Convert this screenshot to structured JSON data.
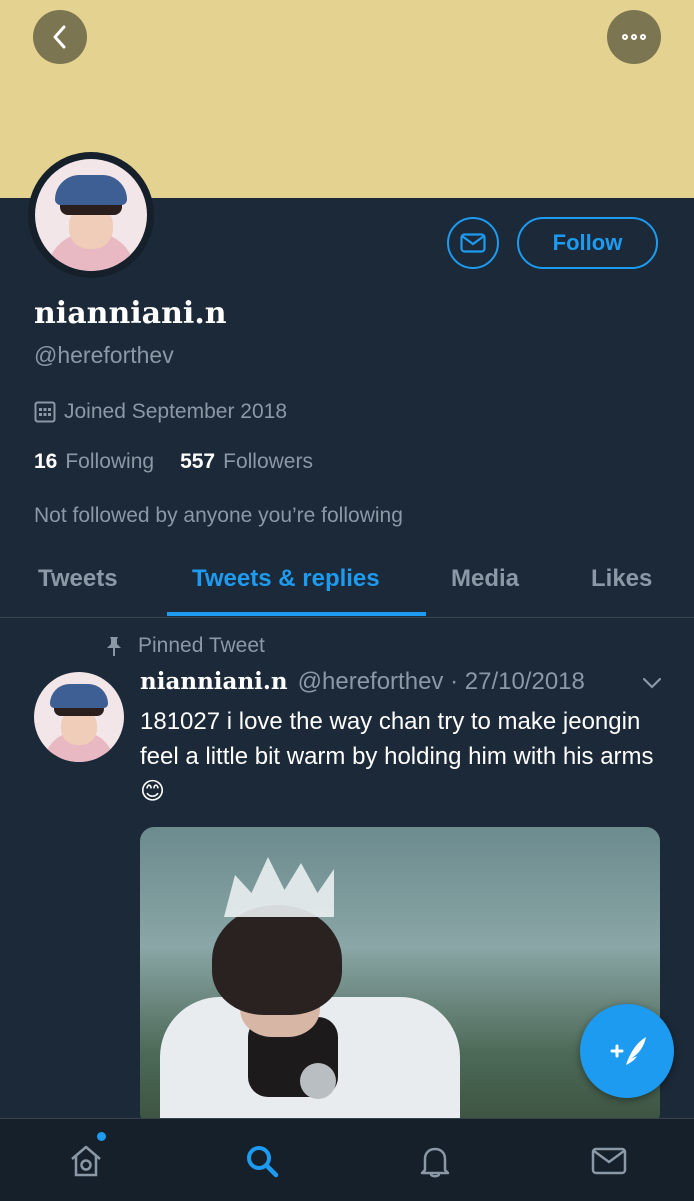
{
  "header": {
    "banner_color": "#e4d390",
    "back_icon": "chevron-left-icon",
    "more_icon": "more-dots-icon"
  },
  "profile": {
    "display_name": "nianniani.n",
    "handle": "@hereforthev",
    "joined": "Joined September 2018",
    "following_count": "16",
    "following_label": "Following",
    "followers_count": "557",
    "followers_label": "Followers",
    "followed_by": "Not followed by anyone you’re following",
    "follow_label": "Follow"
  },
  "tabs": [
    {
      "label": "Tweets"
    },
    {
      "label": "Tweets & replies"
    },
    {
      "label": "Media"
    },
    {
      "label": "Likes"
    }
  ],
  "active_tab": "Tweets & replies",
  "pinned_tweet": {
    "pinned_label": "Pinned Tweet",
    "author_name": "nianniani.n",
    "author_handle": "@hereforthev",
    "date": "27/10/2018",
    "text": "181027 i love the way chan try to make jeongin feel a little bit warm by holding him with his arms 😊"
  },
  "tabbar": {
    "items": [
      "home-icon",
      "search-icon",
      "notifications-icon",
      "messages-icon"
    ],
    "active": "search-icon"
  },
  "colors": {
    "accent": "#1d9bf0",
    "background": "#1c2938",
    "secondary_text": "#8b98a5"
  }
}
